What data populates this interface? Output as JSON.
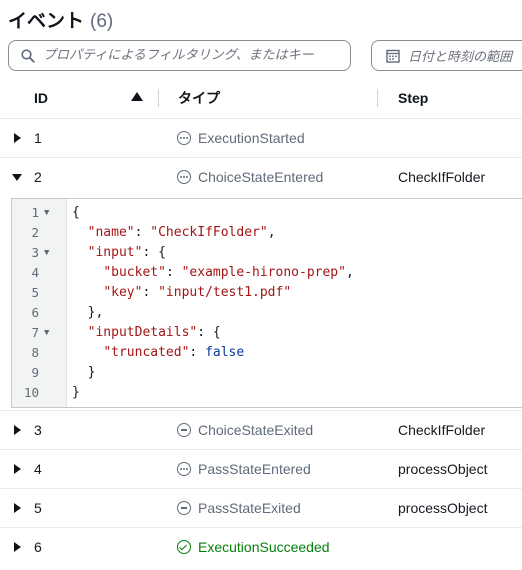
{
  "header": {
    "title": "イベント",
    "count": "(6)"
  },
  "search": {
    "placeholder": "プロパティによるフィルタリング、またはキー",
    "icon": "search-icon"
  },
  "date_filter": {
    "label": "日付と時刻の範囲",
    "icon": "calendar-icon"
  },
  "columns": {
    "id": "ID",
    "type": "タイプ",
    "step": "Step"
  },
  "rows": [
    {
      "id": "1",
      "type": "ExecutionStarted",
      "step": "",
      "icon": "in-progress-icon",
      "expanded": false
    },
    {
      "id": "2",
      "type": "ChoiceStateEntered",
      "step": "CheckIfFolder",
      "icon": "in-progress-icon",
      "expanded": true
    },
    {
      "id": "3",
      "type": "ChoiceStateExited",
      "step": "CheckIfFolder",
      "icon": "stopped-icon",
      "expanded": false
    },
    {
      "id": "4",
      "type": "PassStateEntered",
      "step": "processObject",
      "icon": "in-progress-icon",
      "expanded": false
    },
    {
      "id": "5",
      "type": "PassStateExited",
      "step": "processObject",
      "icon": "stopped-icon",
      "expanded": false
    },
    {
      "id": "6",
      "type": "ExecutionSucceeded",
      "step": "",
      "icon": "success-icon",
      "expanded": false
    }
  ],
  "code": {
    "line_numbers": [
      "1",
      "2",
      "3",
      "4",
      "5",
      "6",
      "7",
      "8",
      "9",
      "10"
    ],
    "l1": "{",
    "l2_key": "\"name\"",
    "l2_val": "\"CheckIfFolder\"",
    "l3_key": "\"input\"",
    "l4_key": "\"bucket\"",
    "l4_val": "\"example-hirono-prep\"",
    "l5_key": "\"key\"",
    "l5_val": "\"input/test1.pdf\"",
    "l6": "},",
    "l7_key": "\"inputDetails\"",
    "l8_key": "\"truncated\"",
    "l8_val": "false",
    "l9": "}",
    "l10": "}"
  },
  "colors": {
    "success": "#037f0c",
    "muted": "#5f6b7a",
    "json_string": "#a31515",
    "json_boolean": "#0b3a99"
  }
}
